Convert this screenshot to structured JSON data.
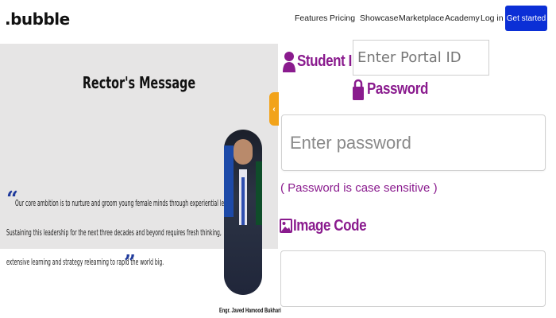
{
  "nav": {
    "logo": ".bubble",
    "links": [
      "Features",
      "Pricing",
      "Showcase",
      "Marketplace",
      "Academy",
      "Log in"
    ],
    "cta": "Get started",
    "cta_color": "#0b2fd6"
  },
  "rector": {
    "title": "Rector's Message",
    "quote_lines": [
      "Our core ambition is to nurture and groom young female minds through experiential learning",
      "Sustaining this leadership for the next three decades and beyond requires fresh thinking,",
      "extensive learning and strategy relearning to rapid the world big."
    ],
    "name": "Engr. Javed Hamood Bukhari"
  },
  "login": {
    "student_id_label": "Student ID",
    "portal_placeholder": "Enter Portal ID",
    "password_label": "Password",
    "password_placeholder": "Enter password",
    "case_note": "( Password is case sensitive )",
    "image_code_label": "Image Code",
    "accent_color": "#8a1b8e"
  },
  "icons": {
    "student": "user-icon",
    "password": "lock-icon",
    "image_code": "image-icon",
    "slider": "chevron-left-icon"
  }
}
